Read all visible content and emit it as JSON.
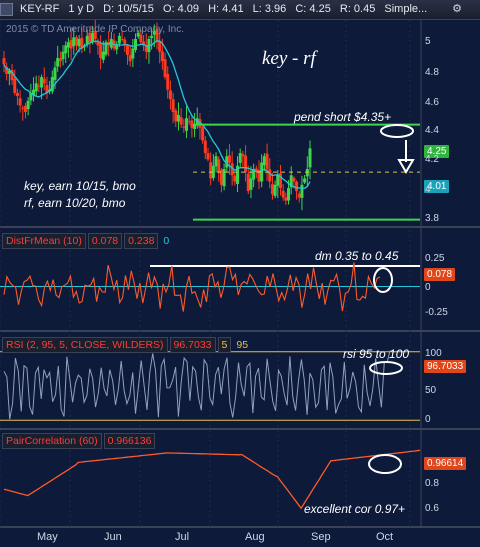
{
  "header": {
    "symbol": "KEY-RF",
    "period": "1 y D",
    "date": "D: 10/5/15",
    "open": "O: 4.09",
    "high": "H: 4.41",
    "low": "L: 3.96",
    "close": "C: 4.25",
    "ratio": "R: 0.45",
    "style": "Simple..."
  },
  "copyright": "2015 © TD Ameritrade IP Company, Inc.",
  "annotations": {
    "title": "key - rf",
    "pend_short": "pend short $4.35+",
    "earnings": "key, earn 10/15, bmo",
    "earnings2": "rf, earn 10/20, bmo",
    "dm": "dm 0.35 to 0.45",
    "rsi": "rsi 95 to 100",
    "cor": "excellent cor 0.97+"
  },
  "panels": {
    "dfm": {
      "name": "DistFrMean (10)",
      "v1": "0.078",
      "v2": "0.238",
      "v3": "0"
    },
    "rsi": {
      "name": "RSI (2, 95, 5, CLOSE, WILDERS)",
      "v1": "96.7033",
      "v2": "5",
      "v3": "95"
    },
    "cor": {
      "name": "PairCorrelation (60)",
      "v1": "0.966136"
    }
  },
  "badges": {
    "price_green": "4.25",
    "price_cyan": "4.01",
    "dfm": "0.078",
    "rsi": "96.7033",
    "cor": "0.96614"
  },
  "price_ticks": [
    "5",
    "4.8",
    "4.6",
    "4.4",
    "4.2",
    "4",
    "3.8"
  ],
  "dfm_ticks": [
    "0.25",
    "0",
    "-0.25"
  ],
  "rsi_ticks": [
    "100",
    "50",
    "0"
  ],
  "cor_ticks": [
    "0.8",
    "0.6"
  ],
  "x_labels": [
    "May",
    "Jun",
    "Jul",
    "Aug",
    "Sep",
    "Oct"
  ],
  "colors": {
    "background": "#0d1a3a",
    "up": "#3cd64a",
    "down": "#ff3b1f",
    "ma": "#26c6da",
    "level": "#3cd64a",
    "dfm_line": "#ff5a2a",
    "rsi_line": "#8fa2bf",
    "cor_line": "#ff5a2a"
  },
  "chart_data": [
    {
      "type": "candlestick",
      "title": "KEY-RF 1 y D",
      "y_ticks": [
        5,
        4.8,
        4.6,
        4.4,
        4.2,
        4.0,
        3.8
      ],
      "ylim": [
        3.76,
        5.06
      ],
      "x_ticks": [
        "May",
        "Jun",
        "Jul",
        "Aug",
        "Sep",
        "Oct"
      ],
      "levels": [
        4.4,
        4.0,
        3.8
      ],
      "last_close": 4.25,
      "ma_last": 4.01,
      "closes": [
        4.78,
        4.72,
        4.74,
        4.68,
        4.6,
        4.58,
        4.52,
        4.5,
        4.48,
        4.55,
        4.6,
        4.62,
        4.66,
        4.64,
        4.7,
        4.66,
        4.6,
        4.62,
        4.7,
        4.76,
        4.82,
        4.8,
        4.86,
        4.9,
        4.92,
        4.88,
        4.95,
        4.9,
        4.94,
        4.88,
        4.9,
        4.96,
        4.92,
        4.98,
        4.94,
        4.9,
        4.82,
        4.86,
        4.92,
        4.9,
        4.94,
        4.88,
        4.9,
        4.96,
        4.94,
        4.9,
        4.84,
        4.8,
        4.88,
        4.94,
        4.98,
        4.92,
        4.9,
        4.86,
        4.94,
        4.96,
        4.99,
        4.92,
        4.86,
        4.8,
        4.7,
        4.62,
        4.56,
        4.48,
        4.42,
        4.46,
        4.4,
        4.38,
        4.44,
        4.42,
        4.38,
        4.4,
        4.44,
        4.38,
        4.3,
        4.22,
        4.18,
        4.06,
        4.14,
        4.2,
        4.1,
        4.02,
        4.12,
        4.2,
        4.16,
        4.08,
        4.04,
        4.14,
        4.22,
        4.2,
        4.1,
        3.98,
        4.06,
        4.12,
        4.1,
        4.04,
        4.16,
        4.2,
        4.12,
        4.04,
        3.96,
        4.02,
        4.08,
        4.0,
        3.94,
        3.92,
        4.0,
        4.08,
        4.04,
        3.98,
        3.94,
        4.02,
        4.06,
        4.12,
        4.25
      ]
    },
    {
      "type": "line",
      "title": "DistFrMean (10)",
      "y_ticks": [
        0.25,
        0,
        -0.25
      ],
      "ylim": [
        -0.34,
        0.34
      ],
      "reference": 0,
      "last": 0.078
    },
    {
      "type": "line",
      "title": "RSI (2, 95, 5, CLOSE, WILDERS)",
      "y_ticks": [
        100,
        50,
        0
      ],
      "ylim": [
        0,
        100
      ],
      "overbought": 95,
      "oversold": 5,
      "last": 96.7033
    },
    {
      "type": "line",
      "title": "PairCorrelation (60)",
      "y_ticks": [
        0.8,
        0.6
      ],
      "ylim": [
        0.5,
        1.0
      ],
      "last": 0.96614
    }
  ]
}
